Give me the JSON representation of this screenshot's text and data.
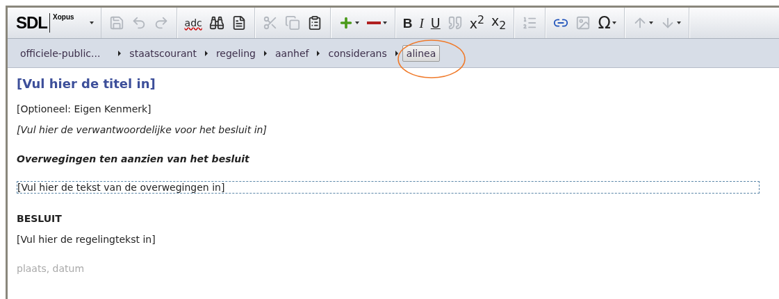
{
  "toolbar": {
    "logo": "SDL",
    "product": "Xopus",
    "groups": [
      [
        {
          "kind": "save",
          "disabled": true,
          "menu": false
        },
        {
          "kind": "undo",
          "disabled": true,
          "menu": false
        },
        {
          "kind": "redo",
          "disabled": true,
          "menu": false
        }
      ],
      [
        {
          "kind": "spell",
          "label": "adc",
          "disabled": false,
          "menu": false
        },
        {
          "kind": "find",
          "disabled": false,
          "menu": false
        },
        {
          "kind": "document",
          "disabled": false,
          "menu": false
        }
      ],
      [
        {
          "kind": "cut",
          "disabled": true,
          "menu": false
        },
        {
          "kind": "copy",
          "disabled": true,
          "menu": false
        },
        {
          "kind": "paste",
          "disabled": false,
          "menu": false
        }
      ],
      [
        {
          "kind": "add",
          "disabled": false,
          "menu": true
        },
        {
          "kind": "remove",
          "disabled": false,
          "menu": true
        }
      ],
      [
        {
          "kind": "bold",
          "label": "B",
          "disabled": false,
          "menu": false
        },
        {
          "kind": "italic",
          "label": "I",
          "disabled": false,
          "menu": false
        },
        {
          "kind": "underline",
          "label": "U",
          "disabled": false,
          "menu": false
        },
        {
          "kind": "quote",
          "disabled": true,
          "menu": false
        },
        {
          "kind": "superscript",
          "label": "x$^{2}$",
          "disabled": false,
          "menu": false
        },
        {
          "kind": "subscript",
          "label": "x$_{2}$",
          "disabled": false,
          "menu": false
        }
      ],
      [
        {
          "kind": "list",
          "disabled": true,
          "menu": false
        }
      ],
      [
        {
          "kind": "link",
          "disabled": false,
          "menu": false
        },
        {
          "kind": "image",
          "disabled": true,
          "menu": false
        },
        {
          "kind": "symbol",
          "label": "Ω",
          "disabled": false,
          "menu": true
        }
      ],
      [
        {
          "kind": "up",
          "disabled": true,
          "menu": true
        },
        {
          "kind": "down",
          "disabled": true,
          "menu": true
        }
      ]
    ]
  },
  "breadcrumb": [
    {
      "label": "officiele-public...",
      "selected": false
    },
    {
      "label": "staatscourant",
      "selected": false
    },
    {
      "label": "regeling",
      "selected": false
    },
    {
      "label": "aanhef",
      "selected": false
    },
    {
      "label": "considerans",
      "selected": false
    },
    {
      "label": "alinea",
      "selected": true
    }
  ],
  "document": [
    {
      "kind": "title",
      "text": "[Vul hier de titel in]"
    },
    {
      "kind": "plain",
      "text": "[Optioneel: Eigen Kenmerk]"
    },
    {
      "kind": "italic",
      "text": "[Vul hier de verwantwoordelijke voor het besluit in]"
    },
    {
      "kind": "subheading",
      "text": "Overwegingen ten aanzien van het besluit"
    },
    {
      "kind": "field",
      "text": "[Vul hier de tekst van de overwegingen in]"
    },
    {
      "kind": "heading",
      "text": "BESLUIT"
    },
    {
      "kind": "plain",
      "text": "[Vul hier de regelingtekst in]"
    },
    {
      "kind": "faded",
      "text": "plaats, datum"
    }
  ]
}
